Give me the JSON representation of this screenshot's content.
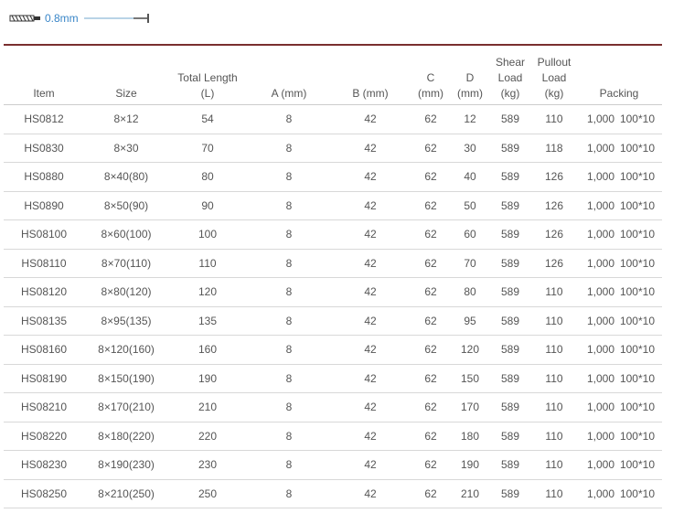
{
  "header": {
    "size_label": "0.8mm"
  },
  "columns": {
    "item": "Item",
    "size": "Size",
    "total_length_1": "Total Length",
    "total_length_2": "(L)",
    "a": "A (mm)",
    "b": "B (mm)",
    "c_1": "C",
    "c_2": "(mm)",
    "d_1": "D",
    "d_2": "(mm)",
    "shear_1": "Shear",
    "shear_2": "Load",
    "shear_3": "(kg)",
    "pullout_1": "Pullout",
    "pullout_2": "Load",
    "pullout_3": "(kg)",
    "packing": "Packing"
  },
  "rows": [
    {
      "item": "HS0812",
      "size": "8×12",
      "l": "54",
      "a": "8",
      "b": "42",
      "c": "62",
      "d": "12",
      "shear": "589",
      "pullout": "110",
      "pack1": "1,000",
      "pack2": "100*10"
    },
    {
      "item": "HS0830",
      "size": "8×30",
      "l": "70",
      "a": "8",
      "b": "42",
      "c": "62",
      "d": "30",
      "shear": "589",
      "pullout": "118",
      "pack1": "1,000",
      "pack2": "100*10"
    },
    {
      "item": "HS0880",
      "size": "8×40(80)",
      "l": "80",
      "a": "8",
      "b": "42",
      "c": "62",
      "d": "40",
      "shear": "589",
      "pullout": "126",
      "pack1": "1,000",
      "pack2": "100*10"
    },
    {
      "item": "HS0890",
      "size": "8×50(90)",
      "l": "90",
      "a": "8",
      "b": "42",
      "c": "62",
      "d": "50",
      "shear": "589",
      "pullout": "126",
      "pack1": "1,000",
      "pack2": "100*10"
    },
    {
      "item": "HS08100",
      "size": "8×60(100)",
      "l": "100",
      "a": "8",
      "b": "42",
      "c": "62",
      "d": "60",
      "shear": "589",
      "pullout": "126",
      "pack1": "1,000",
      "pack2": "100*10"
    },
    {
      "item": "HS08110",
      "size": "8×70(110)",
      "l": "110",
      "a": "8",
      "b": "42",
      "c": "62",
      "d": "70",
      "shear": "589",
      "pullout": "126",
      "pack1": "1,000",
      "pack2": "100*10"
    },
    {
      "item": "HS08120",
      "size": "8×80(120)",
      "l": "120",
      "a": "8",
      "b": "42",
      "c": "62",
      "d": "80",
      "shear": "589",
      "pullout": "110",
      "pack1": "1,000",
      "pack2": "100*10"
    },
    {
      "item": "HS08135",
      "size": "8×95(135)",
      "l": "135",
      "a": "8",
      "b": "42",
      "c": "62",
      "d": "95",
      "shear": "589",
      "pullout": "110",
      "pack1": "1,000",
      "pack2": "100*10"
    },
    {
      "item": "HS08160",
      "size": "8×120(160)",
      "l": "160",
      "a": "8",
      "b": "42",
      "c": "62",
      "d": "120",
      "shear": "589",
      "pullout": "110",
      "pack1": "1,000",
      "pack2": "100*10"
    },
    {
      "item": "HS08190",
      "size": "8×150(190)",
      "l": "190",
      "a": "8",
      "b": "42",
      "c": "62",
      "d": "150",
      "shear": "589",
      "pullout": "110",
      "pack1": "1,000",
      "pack2": "100*10"
    },
    {
      "item": "HS08210",
      "size": "8×170(210)",
      "l": "210",
      "a": "8",
      "b": "42",
      "c": "62",
      "d": "170",
      "shear": "589",
      "pullout": "110",
      "pack1": "1,000",
      "pack2": "100*10"
    },
    {
      "item": "HS08220",
      "size": "8×180(220)",
      "l": "220",
      "a": "8",
      "b": "42",
      "c": "62",
      "d": "180",
      "shear": "589",
      "pullout": "110",
      "pack1": "1,000",
      "pack2": "100*10"
    },
    {
      "item": "HS08230",
      "size": "8×190(230)",
      "l": "230",
      "a": "8",
      "b": "42",
      "c": "62",
      "d": "190",
      "shear": "589",
      "pullout": "110",
      "pack1": "1,000",
      "pack2": "100*10"
    },
    {
      "item": "HS08250",
      "size": "8×210(250)",
      "l": "250",
      "a": "8",
      "b": "42",
      "c": "62",
      "d": "210",
      "shear": "589",
      "pullout": "110",
      "pack1": "1,000",
      "pack2": "100*10"
    }
  ],
  "icons": {
    "drill": "drill-bit-icon",
    "rod": "anchor-rod-icon"
  },
  "colors": {
    "divider": "#7a2f2f",
    "size_label": "#3a86c8",
    "text": "#555555"
  }
}
